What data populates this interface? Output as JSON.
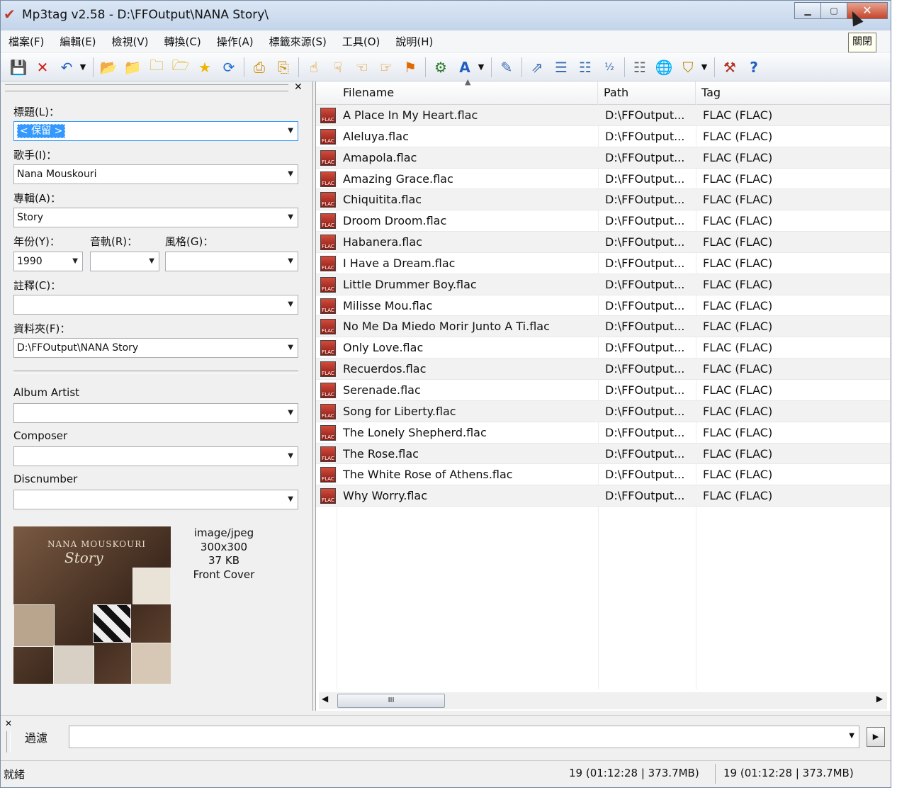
{
  "window": {
    "title": "Mp3tag v2.58  -  D:\\FFOutput\\NANA Story\\",
    "minimize_icon": "minimize-icon",
    "maximize_icon": "maximize-icon",
    "close_label": "✕",
    "close_tooltip": "關閉"
  },
  "menu": [
    "檔案(F)",
    "編輯(E)",
    "檢視(V)",
    "轉換(C)",
    "操作(A)",
    "標籤來源(S)",
    "工具(O)",
    "說明(H)"
  ],
  "toolbar": {
    "groups": [
      [
        "save-icon",
        "delete-icon",
        "undo-icon",
        "dropdown-arrow-icon"
      ],
      [
        "change-directory-icon",
        "add-directory-icon",
        "folder-open-icon",
        "folder-refresh-icon",
        "favorites-star-icon",
        "refresh-icon"
      ],
      [
        "select-all-icon",
        "select-rows-icon"
      ],
      [
        "tag-filename-icon",
        "filename-tag-icon",
        "filename-filename-icon",
        "text-file-tag-icon",
        "tag-tag-icon"
      ],
      [
        "actions-icon",
        "actions-quick-icon",
        "dropdown-arrow-icon"
      ],
      [
        "extended-tags-icon"
      ],
      [
        "export-icon",
        "playlist-icon",
        "playlist-selected-icon",
        "autonumber-icon"
      ],
      [
        "freedb-icon",
        "web-sources-icon",
        "tag-sources-icon",
        "dropdown-arrow-icon"
      ],
      [
        "options-icon",
        "help-icon"
      ]
    ]
  },
  "tag_panel": {
    "fields": [
      {
        "label": "標題(L)：",
        "value": "< 保留 >",
        "selected": true
      },
      {
        "label": "歌手(I)：",
        "value": "Nana Mouskouri"
      },
      {
        "label": "專輯(A)：",
        "value": "Story"
      }
    ],
    "year": {
      "label": "年份(Y)：",
      "value": "1990"
    },
    "track": {
      "label": "音軌(R)：",
      "value": ""
    },
    "genre": {
      "label": "風格(G)：",
      "value": ""
    },
    "comment": {
      "label": "註釋(C)：",
      "value": ""
    },
    "directory": {
      "label": "資料夾(F)：",
      "value": "D:\\FFOutput\\NANA Story"
    },
    "extra_fields": [
      {
        "label": "Album Artist",
        "value": ""
      },
      {
        "label": "Composer",
        "value": ""
      },
      {
        "label": "Discnumber",
        "value": ""
      }
    ],
    "cover": {
      "art_title": "NANA MOUSKOURI",
      "art_subtitle": "Story",
      "mime": "image/jpeg",
      "dimensions": "300x300",
      "size": "37 KB",
      "type": "Front Cover"
    }
  },
  "file_list": {
    "columns": [
      "Filename",
      "Path",
      "Tag"
    ],
    "rows": [
      {
        "filename": "A Place In My Heart.flac",
        "path": "D:\\FFOutput...",
        "tag": "FLAC (FLAC)"
      },
      {
        "filename": "Aleluya.flac",
        "path": "D:\\FFOutput...",
        "tag": "FLAC (FLAC)"
      },
      {
        "filename": "Amapola.flac",
        "path": "D:\\FFOutput...",
        "tag": "FLAC (FLAC)"
      },
      {
        "filename": "Amazing Grace.flac",
        "path": "D:\\FFOutput...",
        "tag": "FLAC (FLAC)"
      },
      {
        "filename": "Chiquitita.flac",
        "path": "D:\\FFOutput...",
        "tag": "FLAC (FLAC)"
      },
      {
        "filename": "Droom Droom.flac",
        "path": "D:\\FFOutput...",
        "tag": "FLAC (FLAC)"
      },
      {
        "filename": "Habanera.flac",
        "path": "D:\\FFOutput...",
        "tag": "FLAC (FLAC)"
      },
      {
        "filename": "I Have a Dream.flac",
        "path": "D:\\FFOutput...",
        "tag": "FLAC (FLAC)"
      },
      {
        "filename": "Little Drummer Boy.flac",
        "path": "D:\\FFOutput...",
        "tag": "FLAC (FLAC)"
      },
      {
        "filename": "Milisse Mou.flac",
        "path": "D:\\FFOutput...",
        "tag": "FLAC (FLAC)"
      },
      {
        "filename": "No Me Da Miedo Morir Junto A Ti.flac",
        "path": "D:\\FFOutput...",
        "tag": "FLAC (FLAC)"
      },
      {
        "filename": "Only Love.flac",
        "path": "D:\\FFOutput...",
        "tag": "FLAC (FLAC)"
      },
      {
        "filename": "Recuerdos.flac",
        "path": "D:\\FFOutput...",
        "tag": "FLAC (FLAC)"
      },
      {
        "filename": "Serenade.flac",
        "path": "D:\\FFOutput...",
        "tag": "FLAC (FLAC)"
      },
      {
        "filename": "Song for Liberty.flac",
        "path": "D:\\FFOutput...",
        "tag": "FLAC (FLAC)"
      },
      {
        "filename": "The Lonely Shepherd.flac",
        "path": "D:\\FFOutput...",
        "tag": "FLAC (FLAC)"
      },
      {
        "filename": "The Rose.flac",
        "path": "D:\\FFOutput...",
        "tag": "FLAC (FLAC)"
      },
      {
        "filename": "The White Rose of Athens.flac",
        "path": "D:\\FFOutput...",
        "tag": "FLAC (FLAC)"
      },
      {
        "filename": "Why Worry.flac",
        "path": "D:\\FFOutput...",
        "tag": "FLAC (FLAC)"
      }
    ],
    "file_icon_text": "FLAC",
    "scroll_thumb_label": "III"
  },
  "filter": {
    "label": "過濾",
    "value": ""
  },
  "status": {
    "left": "就緒",
    "selected_summary": "19 (01:12:28 | 373.7MB)",
    "total_summary": "19 (01:12:28 | 373.7MB)"
  },
  "colors": {
    "accent": "#3399ff",
    "flac_icon": "#c0392b"
  }
}
